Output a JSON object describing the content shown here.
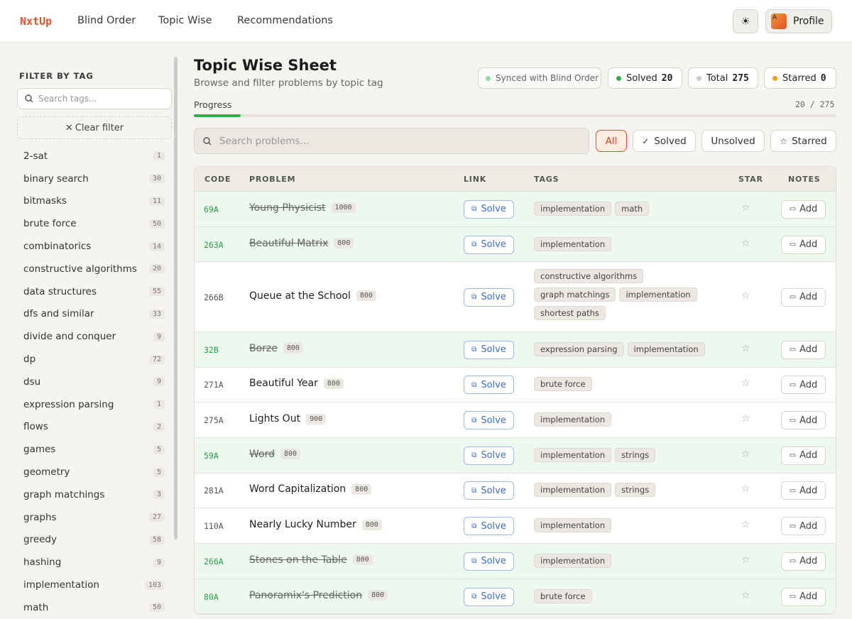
{
  "nav": {
    "logo": "NxtUp",
    "links": [
      "Blind Order",
      "Topic Wise",
      "Recommendations"
    ],
    "theme_icon": "sun-icon",
    "avatar_letter": "A",
    "profile_label": "Profile"
  },
  "sidebar": {
    "title": "FILTER BY TAG",
    "search_placeholder": "Search tags...",
    "clear_label": "Clear filter",
    "tags": [
      {
        "name": "2-sat",
        "count": "1"
      },
      {
        "name": "binary search",
        "count": "30"
      },
      {
        "name": "bitmasks",
        "count": "11"
      },
      {
        "name": "brute force",
        "count": "50"
      },
      {
        "name": "combinatorics",
        "count": "14"
      },
      {
        "name": "constructive algorithms",
        "count": "20"
      },
      {
        "name": "data structures",
        "count": "55"
      },
      {
        "name": "dfs and similar",
        "count": "33"
      },
      {
        "name": "divide and conquer",
        "count": "9"
      },
      {
        "name": "dp",
        "count": "72"
      },
      {
        "name": "dsu",
        "count": "9"
      },
      {
        "name": "expression parsing",
        "count": "1"
      },
      {
        "name": "flows",
        "count": "2"
      },
      {
        "name": "games",
        "count": "5"
      },
      {
        "name": "geometry",
        "count": "5"
      },
      {
        "name": "graph matchings",
        "count": "3"
      },
      {
        "name": "graphs",
        "count": "27"
      },
      {
        "name": "greedy",
        "count": "58"
      },
      {
        "name": "hashing",
        "count": "9"
      },
      {
        "name": "implementation",
        "count": "103"
      },
      {
        "name": "math",
        "count": "50"
      }
    ]
  },
  "header": {
    "title": "Topic Wise Sheet",
    "subtitle": "Browse and filter problems by topic tag",
    "synced": "Synced with Blind Order",
    "solved_label": "Solved",
    "solved_value": "20",
    "total_label": "Total",
    "total_value": "275",
    "starred_label": "Starred",
    "starred_value": "0"
  },
  "progress": {
    "label": "Progress",
    "text": "20 / 275",
    "fraction": 0.0727
  },
  "filters": {
    "search_placeholder": "Search problems...",
    "all": "All",
    "solved": "Solved",
    "unsolved": "Unsolved",
    "starred": "Starred"
  },
  "table": {
    "headers": [
      "CODE",
      "PROBLEM",
      "LINK",
      "TAGS",
      "STAR",
      "NOTES"
    ],
    "solve_label": "Solve",
    "notes_label": "Add",
    "rows": [
      {
        "code": "69A",
        "name": "Young Physicist",
        "rating": "1000",
        "solved": true,
        "tags": [
          "implementation",
          "math"
        ]
      },
      {
        "code": "263A",
        "name": "Beautiful Matrix",
        "rating": "800",
        "solved": true,
        "tags": [
          "implementation"
        ]
      },
      {
        "code": "266B",
        "name": "Queue at the School",
        "rating": "800",
        "solved": false,
        "tags": [
          "constructive algorithms",
          "graph matchings",
          "implementation",
          "shortest paths"
        ]
      },
      {
        "code": "32B",
        "name": "Borze",
        "rating": "800",
        "solved": true,
        "tags": [
          "expression parsing",
          "implementation"
        ]
      },
      {
        "code": "271A",
        "name": "Beautiful Year",
        "rating": "800",
        "solved": false,
        "tags": [
          "brute force"
        ]
      },
      {
        "code": "275A",
        "name": "Lights Out",
        "rating": "900",
        "solved": false,
        "tags": [
          "implementation"
        ]
      },
      {
        "code": "59A",
        "name": "Word",
        "rating": "800",
        "solved": true,
        "tags": [
          "implementation",
          "strings"
        ]
      },
      {
        "code": "281A",
        "name": "Word Capitalization",
        "rating": "800",
        "solved": false,
        "tags": [
          "implementation",
          "strings"
        ]
      },
      {
        "code": "110A",
        "name": "Nearly Lucky Number",
        "rating": "800",
        "solved": false,
        "tags": [
          "implementation"
        ]
      },
      {
        "code": "266A",
        "name": "Stones on the Table",
        "rating": "800",
        "solved": true,
        "tags": [
          "implementation"
        ]
      },
      {
        "code": "80A",
        "name": "Panoramix's Prediction",
        "rating": "800",
        "solved": true,
        "tags": [
          "brute force"
        ]
      }
    ]
  },
  "colors": {
    "accent": "#e5532a",
    "solved_green": "#2bb34e",
    "solved_row_bg": "#edf9ef",
    "link_blue": "#3a6fd0",
    "starred_orange": "#f0a020"
  }
}
